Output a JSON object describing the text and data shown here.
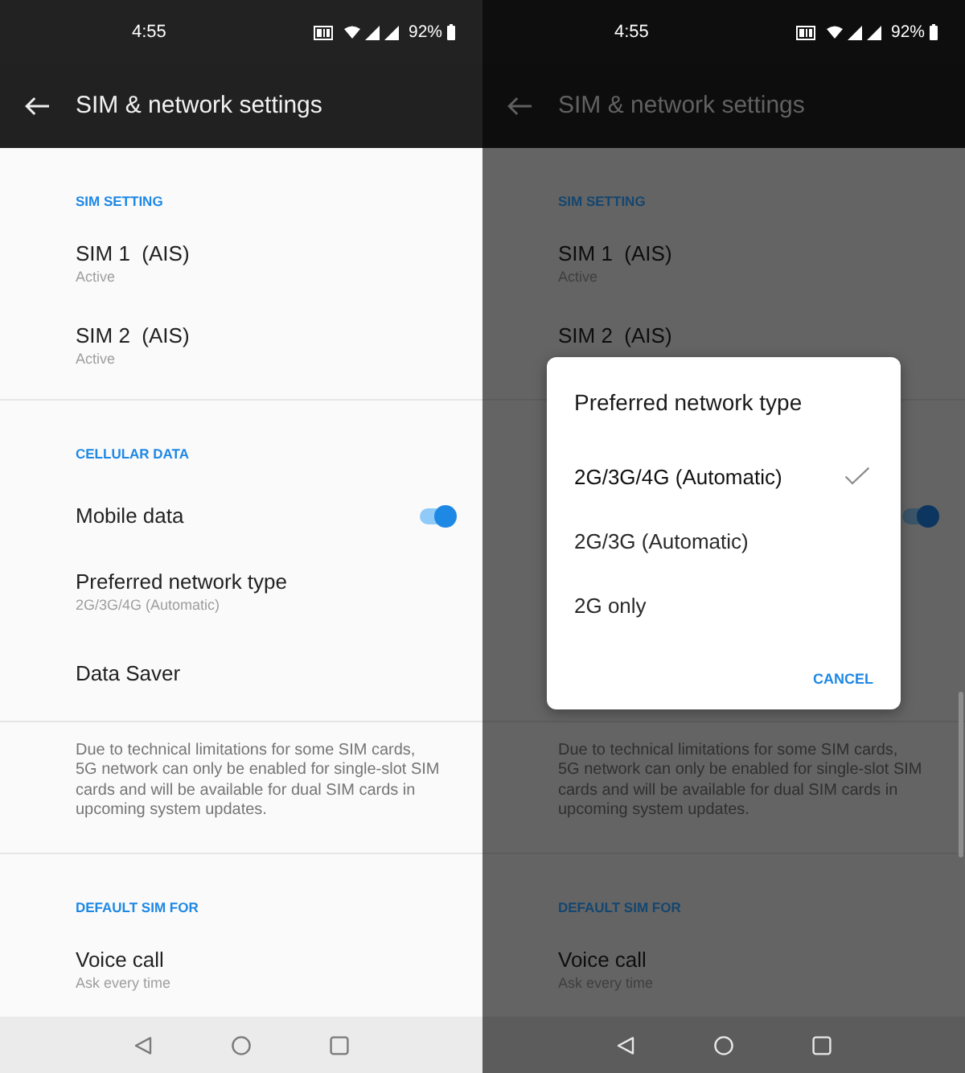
{
  "screens": [
    {
      "dimmed": false,
      "status_bar": {
        "time": "4:55",
        "battery": "92%"
      },
      "app_bar": {
        "title": "SIM & network settings"
      },
      "sections": [
        {
          "header": "SIM SETTING",
          "items": [
            {
              "kind": "detail",
              "title": "SIM 1  (AIS)",
              "summary": "Active"
            },
            {
              "kind": "detail",
              "title": "SIM 2  (AIS)",
              "summary": "Active"
            }
          ]
        },
        {
          "header": "CELLULAR DATA",
          "items": [
            {
              "kind": "switch",
              "title": "Mobile data",
              "on": true
            },
            {
              "kind": "detail",
              "title": "Preferred network type",
              "summary": "2G/3G/4G (Automatic)"
            },
            {
              "kind": "text",
              "title": "Data Saver"
            }
          ]
        },
        {
          "note": "Due to technical limitations for some SIM cards, 5G network can only be enabled for single-slot SIM cards and will be available for dual SIM cards in upcoming system updates."
        },
        {
          "header": "DEFAULT SIM FOR",
          "items": [
            {
              "kind": "detail",
              "title": "Voice call",
              "summary": "Ask every time"
            }
          ]
        }
      ]
    },
    {
      "dimmed": true,
      "scroll_indicator": true,
      "status_bar": {
        "time": "4:55",
        "battery": "92%"
      },
      "app_bar": {
        "title": "SIM & network settings"
      },
      "sections": [
        {
          "header": "SIM SETTING",
          "items": [
            {
              "kind": "detail",
              "title": "SIM 1  (AIS)",
              "summary": "Active"
            },
            {
              "kind": "detail",
              "title": "SIM 2  (AIS)"
            }
          ]
        },
        {
          "items": [
            {
              "kind": "switch",
              "on": true
            },
            {
              "kind": "detail"
            },
            {
              "kind": "text"
            }
          ]
        },
        {
          "note": "Due to technical limitations for some SIM cards, 5G network can only be enabled for single-slot SIM cards and will be available for dual SIM cards in upcoming system updates."
        },
        {
          "header": "DEFAULT SIM FOR",
          "items": [
            {
              "kind": "detail",
              "title": "Voice call",
              "summary": "Ask every time"
            }
          ]
        }
      ],
      "dialog": {
        "title": "Preferred network type",
        "options": [
          {
            "label": "2G/3G/4G (Automatic)",
            "selected": true
          },
          {
            "label": "2G/3G (Automatic)",
            "selected": false
          },
          {
            "label": "2G only",
            "selected": false
          }
        ],
        "buttons": [
          "CANCEL"
        ]
      }
    }
  ]
}
